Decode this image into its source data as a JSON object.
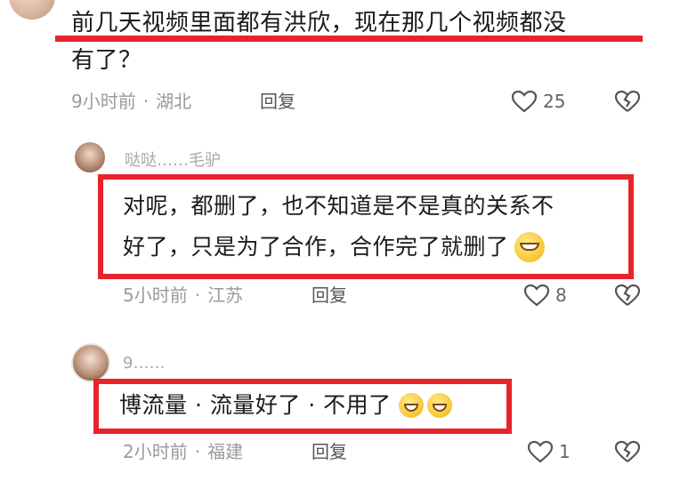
{
  "comment_main": {
    "text_line1": "前几天视频里面都有洪欣，现在那几个视频都没",
    "text_line2": "有了？",
    "time": "9小时前",
    "location": "湖北",
    "reply_label": "回复",
    "likes": "25"
  },
  "reply1": {
    "username": "哒哒……毛驴",
    "text_line1": "对呢，都删了，也不知道是不是真的关系不",
    "text_line2": "好了，只是为了合作，合作完了就删了",
    "time": "5小时前",
    "location": "江苏",
    "reply_label": "回复",
    "likes": "8"
  },
  "reply2": {
    "username": "9……",
    "text": "博流量 · 流量好了 · 不用了",
    "time": "2小时前",
    "location": "福建",
    "reply_label": "回复",
    "likes": "1"
  },
  "colors": {
    "highlight": "#e8232b",
    "meta": "#9a9a9a"
  }
}
